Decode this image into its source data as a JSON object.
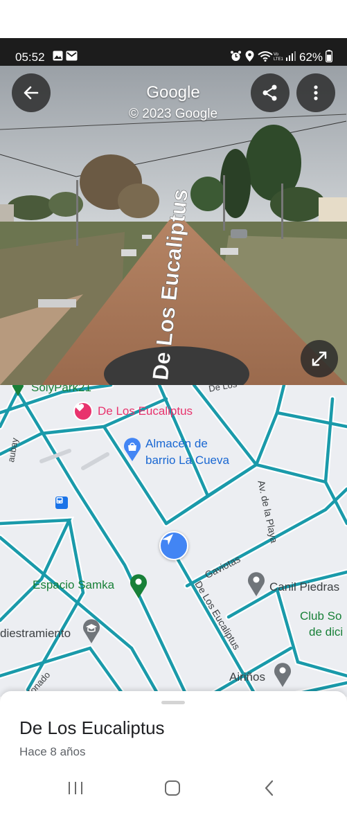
{
  "status_bar": {
    "time": "05:52",
    "battery": "62%",
    "left_icons": [
      "image-icon",
      "mail-icon"
    ],
    "right_icons": [
      "alarm-icon",
      "location-icon",
      "wifi-icon",
      "volte-icon",
      "signal-icon",
      "battery-icon"
    ]
  },
  "street_view": {
    "title": "Google",
    "copyright": "© 2023 Google",
    "road_overlay_label": "De Los Eucaliptus",
    "buttons": [
      "back-icon",
      "share-icon",
      "more-vert-icon",
      "fullscreen-icon"
    ]
  },
  "map": {
    "places": {
      "solypark": "SolyPark21",
      "favorite": "De Los Eucaliptus",
      "almacen_line1": "Almacén de",
      "almacen_line2": "barrio La Cueva",
      "espacio": "Espacio Samka",
      "canil": "Canil Piedras",
      "club_line1": "Club So",
      "club_line2": "de dici",
      "adiestramiento": "diestramiento",
      "airinos": "Airiños"
    },
    "roads": {
      "av_playa": "Av. de la Playa",
      "gaviotas": "Gaviotas",
      "eucaliptus": "De Los Eucaliptus",
      "top_partial": "De Los",
      "left_partial": "aubay",
      "bottom_partial": "lonado"
    },
    "colors": {
      "road": "#1a9aaa",
      "background": "#eceef2",
      "favorite": "#e8336d",
      "shop": "#4285f4",
      "park": "#188038",
      "generic_poi": "#70757a",
      "transit": "#1a73e8"
    }
  },
  "place_sheet": {
    "title": "De Los Eucaliptus",
    "subtitle": "Hace 8 años"
  },
  "nav_bar": {
    "buttons": [
      "recents-icon",
      "home-icon",
      "back-nav-icon"
    ]
  }
}
